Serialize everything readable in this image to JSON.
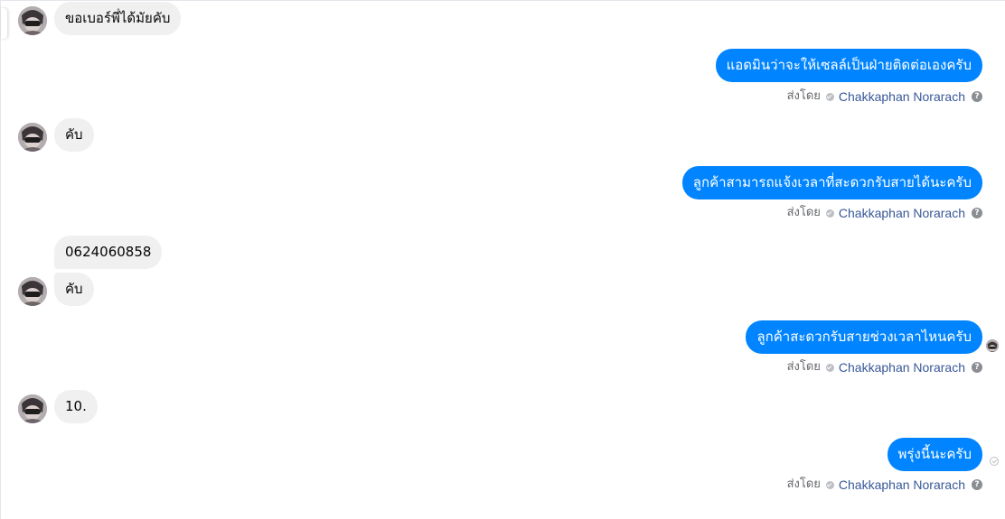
{
  "conversation": {
    "incoming": [
      {
        "text": "ขอเบอร์พี่ได้มัยคับ"
      },
      {
        "text": "คับ"
      },
      {
        "text": "0624060858"
      },
      {
        "text": "คับ"
      },
      {
        "text": "10."
      }
    ],
    "outgoing": [
      {
        "text": "แอดมินว่าจะให้เซลล์เป็นฝ่ายติดต่อเองครับ",
        "sent_by_label": "ส่งโดย",
        "sender": "Chakkaphan Norarach"
      },
      {
        "text": "ลูกค้าสามารถแจ้งเวลาที่สะดวกรับสายได้นะครับ",
        "sent_by_label": "ส่งโดย",
        "sender": "Chakkaphan Norarach"
      },
      {
        "text": "ลูกค้าสะดวกรับสายช่วงเวลาไหนครับ",
        "sent_by_label": "ส่งโดย",
        "sender": "Chakkaphan Norarach",
        "status": "seen"
      },
      {
        "text": "พรุ่งนี้นะครับ",
        "sent_by_label": "ส่งโดย",
        "sender": "Chakkaphan Norarach",
        "status": "sent"
      }
    ]
  },
  "icons": {
    "verified": "check-circle-icon",
    "help": "question-circle-icon",
    "help_glyph": "?"
  },
  "colors": {
    "outgoing_bubble": "#0084ff",
    "incoming_bubble": "#f0f0f0",
    "sender_name": "#385898",
    "meta_text": "#65676b"
  }
}
